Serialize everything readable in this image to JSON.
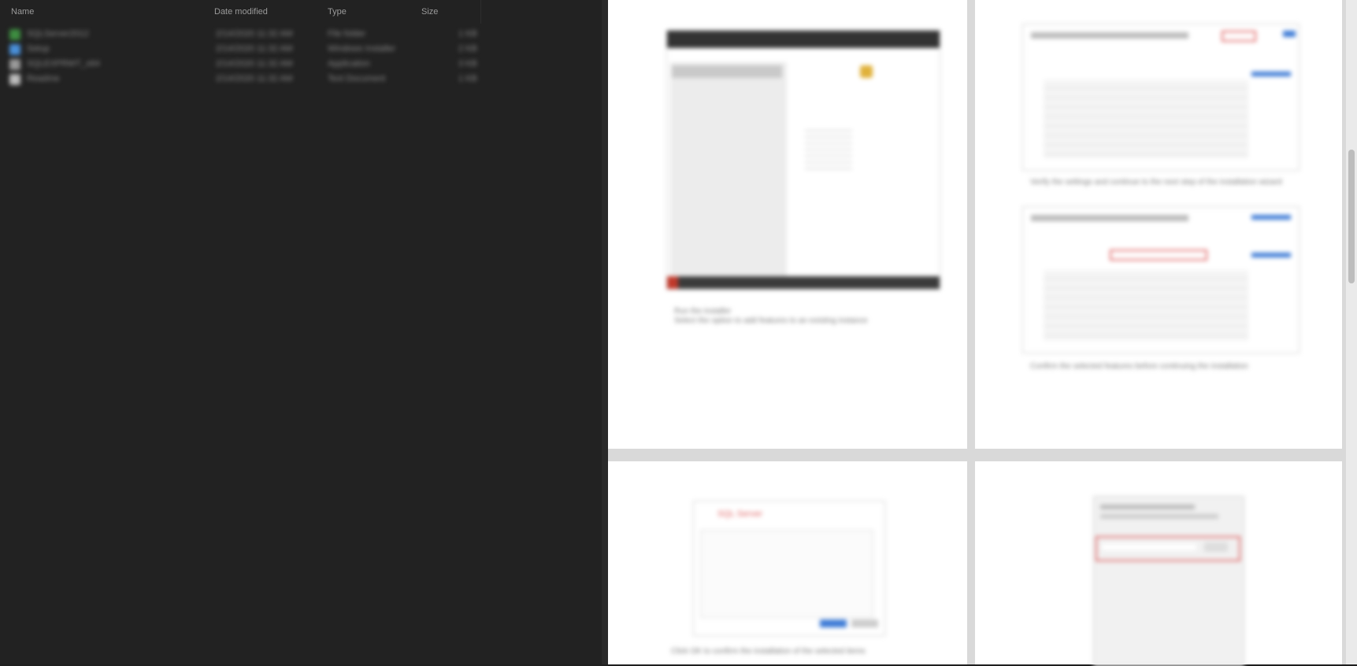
{
  "file_list": {
    "columns": [
      "Name",
      "Date modified",
      "Type",
      "Size"
    ],
    "rows": [
      {
        "name": "SQLServer2012",
        "date": "2/14/2020 11:32 AM",
        "type": "File folder",
        "size": "1 KB",
        "color": "#3e8e41"
      },
      {
        "name": "Setup",
        "date": "2/14/2020 11:32 AM",
        "type": "Windows Installer",
        "size": "2 KB",
        "color": "#4a90d9"
      },
      {
        "name": "SQLEXPRWT_x64",
        "date": "2/14/2020 11:32 AM",
        "type": "Application",
        "size": "3 KB",
        "color": "#9a9a9a"
      },
      {
        "name": "Readme",
        "date": "2/14/2020 11:32 AM",
        "type": "Text Document",
        "size": "1 KB",
        "color": "#bdbdbd"
      }
    ]
  },
  "document": {
    "page1_caption_line1": "Run the installer",
    "page1_caption_line2": "Select the option to add features to an existing instance",
    "page2_note1": "Verify the settings and continue to the next step of the installation wizard",
    "page2_note2": "Confirm the selected features before continuing the installation",
    "page3_caption": "Click OK to confirm the installation of the selected items",
    "page3_dialog_title": "SQL Server"
  },
  "colors": {
    "accent_red": "#e06666",
    "link_blue": "#3d7bd6"
  }
}
